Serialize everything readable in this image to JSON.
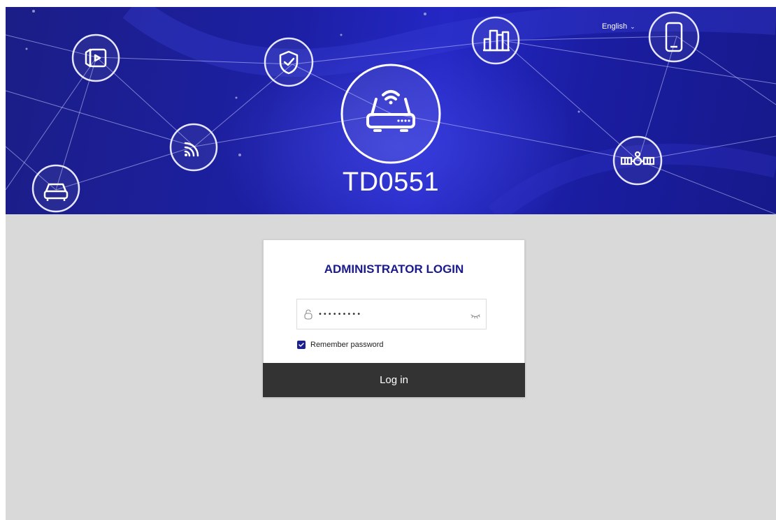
{
  "header": {
    "language_label": "English",
    "language_icon": "chevron-down-icon",
    "model_name": "TD0551",
    "node_icons": [
      "video-icon",
      "shield-icon",
      "city-icon",
      "smartphone-icon",
      "router-icon",
      "wifi-signal-icon",
      "car-icon",
      "satellite-icon"
    ]
  },
  "login": {
    "title": "ADMINISTRATOR LOGIN",
    "password_value": "•••••••••",
    "password_icon": "lock-icon",
    "show_password_icon": "eye-closed-icon",
    "remember_label": "Remember password",
    "remember_checked": true,
    "login_button": "Log in"
  },
  "colors": {
    "accent": "#1c1f8e",
    "banner": "#1c1fa2",
    "button": "#333333",
    "background": "#d9d9d9"
  }
}
